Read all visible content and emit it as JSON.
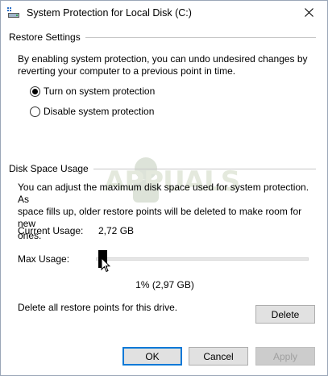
{
  "window": {
    "title": "System Protection for Local Disk (C:)"
  },
  "icons": {
    "app": "system-properties-icon",
    "close": "close-icon",
    "cursor": "mouse-pointer-icon",
    "watermark": "appuals-logo"
  },
  "watermark": {
    "text": "APPUALS"
  },
  "restore_settings": {
    "heading": "Restore Settings",
    "description_line1": "By enabling system protection, you can undo undesired changes by",
    "description_line2": "reverting your computer to a previous point in time.",
    "options": [
      {
        "label": "Turn on system protection",
        "selected": true
      },
      {
        "label": "Disable system protection",
        "selected": false
      }
    ]
  },
  "disk_space": {
    "heading": "Disk Space Usage",
    "description_line1": "You can adjust the maximum disk space used for system protection. As",
    "description_line2": "space fills up, older restore points will be deleted to make room for new",
    "description_line3": "ones.",
    "current_usage_label": "Current Usage:",
    "current_usage_value": "2,72 GB",
    "max_usage_label": "Max Usage:",
    "max_usage_fraction": 0.01,
    "max_usage_readout": "1% (2,97 GB)",
    "delete_text": "Delete all restore points for this drive.",
    "delete_button": "Delete"
  },
  "footer": {
    "ok": "OK",
    "cancel": "Cancel",
    "apply": "Apply",
    "apply_enabled": false
  },
  "colors": {
    "accent": "#0078d7",
    "button_face": "#e1e1e1",
    "divider": "#c7c7c7"
  }
}
